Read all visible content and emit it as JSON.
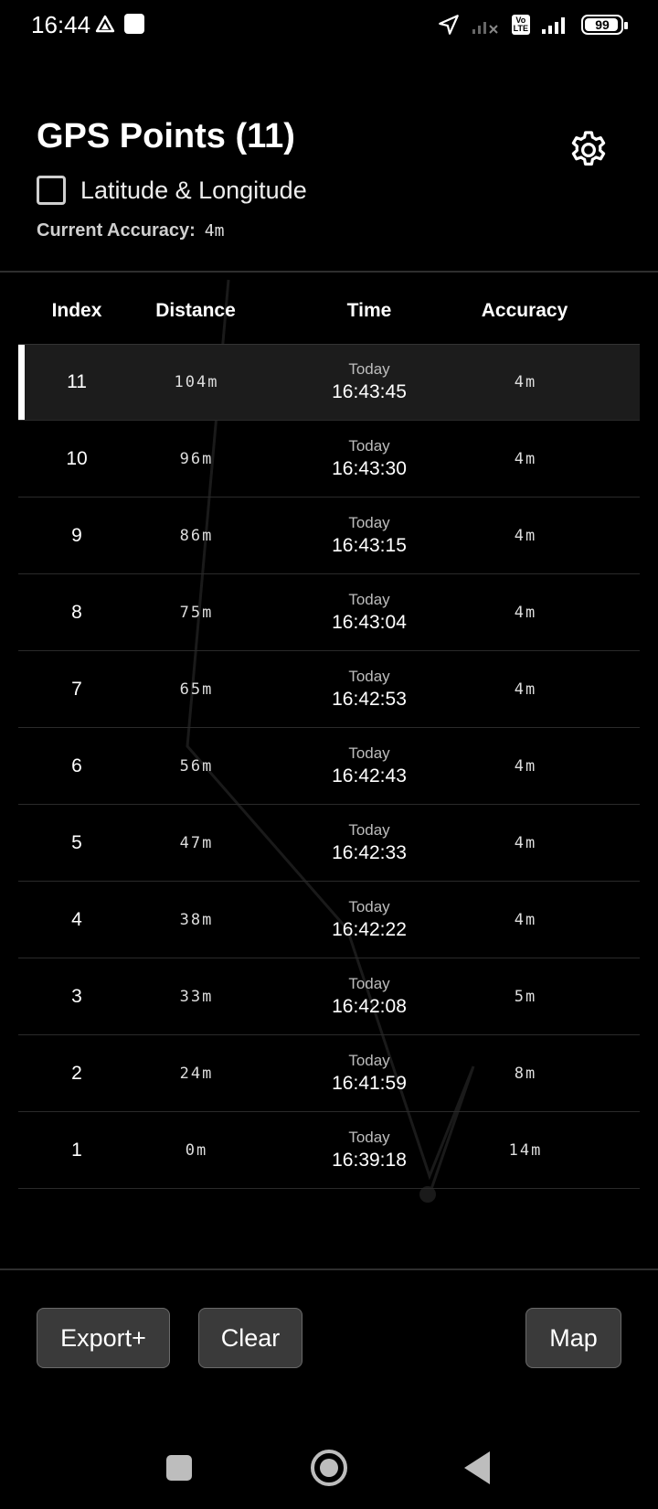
{
  "status_bar": {
    "time": "16:44",
    "battery": "99",
    "volte": "Vo\nLTE"
  },
  "header": {
    "title": "GPS Points (11)",
    "checkbox_label": "Latitude & Longitude",
    "checkbox_checked": false,
    "accuracy_label": "Current Accuracy:",
    "accuracy_value": "4m"
  },
  "table": {
    "headers": {
      "index": "Index",
      "distance": "Distance",
      "time": "Time",
      "accuracy": "Accuracy"
    },
    "rows": [
      {
        "index": "11",
        "distance": "104m",
        "day": "Today",
        "time": "16:43:45",
        "accuracy": "4m"
      },
      {
        "index": "10",
        "distance": "96m",
        "day": "Today",
        "time": "16:43:30",
        "accuracy": "4m"
      },
      {
        "index": "9",
        "distance": "86m",
        "day": "Today",
        "time": "16:43:15",
        "accuracy": "4m"
      },
      {
        "index": "8",
        "distance": "75m",
        "day": "Today",
        "time": "16:43:04",
        "accuracy": "4m"
      },
      {
        "index": "7",
        "distance": "65m",
        "day": "Today",
        "time": "16:42:53",
        "accuracy": "4m"
      },
      {
        "index": "6",
        "distance": "56m",
        "day": "Today",
        "time": "16:42:43",
        "accuracy": "4m"
      },
      {
        "index": "5",
        "distance": "47m",
        "day": "Today",
        "time": "16:42:33",
        "accuracy": "4m"
      },
      {
        "index": "4",
        "distance": "38m",
        "day": "Today",
        "time": "16:42:22",
        "accuracy": "4m"
      },
      {
        "index": "3",
        "distance": "33m",
        "day": "Today",
        "time": "16:42:08",
        "accuracy": "5m"
      },
      {
        "index": "2",
        "distance": "24m",
        "day": "Today",
        "time": "16:41:59",
        "accuracy": "8m"
      },
      {
        "index": "1",
        "distance": "0m",
        "day": "Today",
        "time": "16:39:18",
        "accuracy": "14m"
      }
    ]
  },
  "buttons": {
    "export": "Export+",
    "clear": "Clear",
    "map": "Map"
  }
}
